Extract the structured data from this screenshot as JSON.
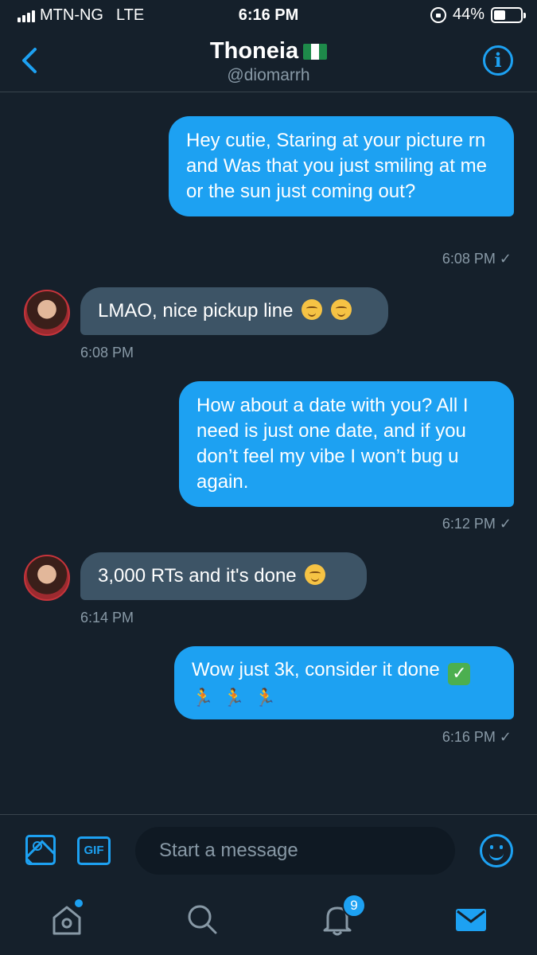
{
  "status_bar": {
    "carrier": "MTN-NG",
    "network": "LTE",
    "time": "6:16 PM",
    "battery": "44%",
    "battery_level": 0.44
  },
  "header": {
    "name": "Thoneia",
    "flag": "nigeria-flag",
    "handle": "@diomarrh"
  },
  "messages": [
    {
      "from": "me",
      "text": "Hey cutie, Staring at your picture rn and Was that you just smiling at me or the sun just coming out?",
      "time": "6:08 PM",
      "status": "sent-check"
    },
    {
      "from": "them",
      "text": "LMAO, nice pickup line",
      "emoji": [
        "smiling-face-icon",
        "smiling-face-icon"
      ],
      "time": "6:08 PM"
    },
    {
      "from": "me",
      "text": "How about a date with you? All I need is just one date, and if you don’t feel my vibe I won’t bug u again.",
      "time": "6:12 PM",
      "status": "sent-check"
    },
    {
      "from": "them",
      "text": "3,000 RTs and it's done",
      "emoji": [
        "kissing-face-icon"
      ],
      "time": "6:14 PM"
    },
    {
      "from": "me",
      "text": "Wow just 3k, consider it done",
      "emoji": [
        "check-mark-button-icon",
        "runner-icon",
        "runner-icon",
        "runner-icon"
      ],
      "time": "6:16 PM",
      "status": "sent-check"
    }
  ],
  "composer": {
    "placeholder": "Start a message",
    "gif_label": "GIF"
  },
  "tab_bar": {
    "items": [
      "home-icon",
      "search-icon",
      "notifications-icon",
      "messages-icon"
    ],
    "notifications_badge": "9",
    "accent": "#1da1f2"
  },
  "colors": {
    "background": "#15202b",
    "sent_bubble": "#1da1f2",
    "received_bubble": "#3d5466",
    "secondary_text": "#8899a6"
  }
}
